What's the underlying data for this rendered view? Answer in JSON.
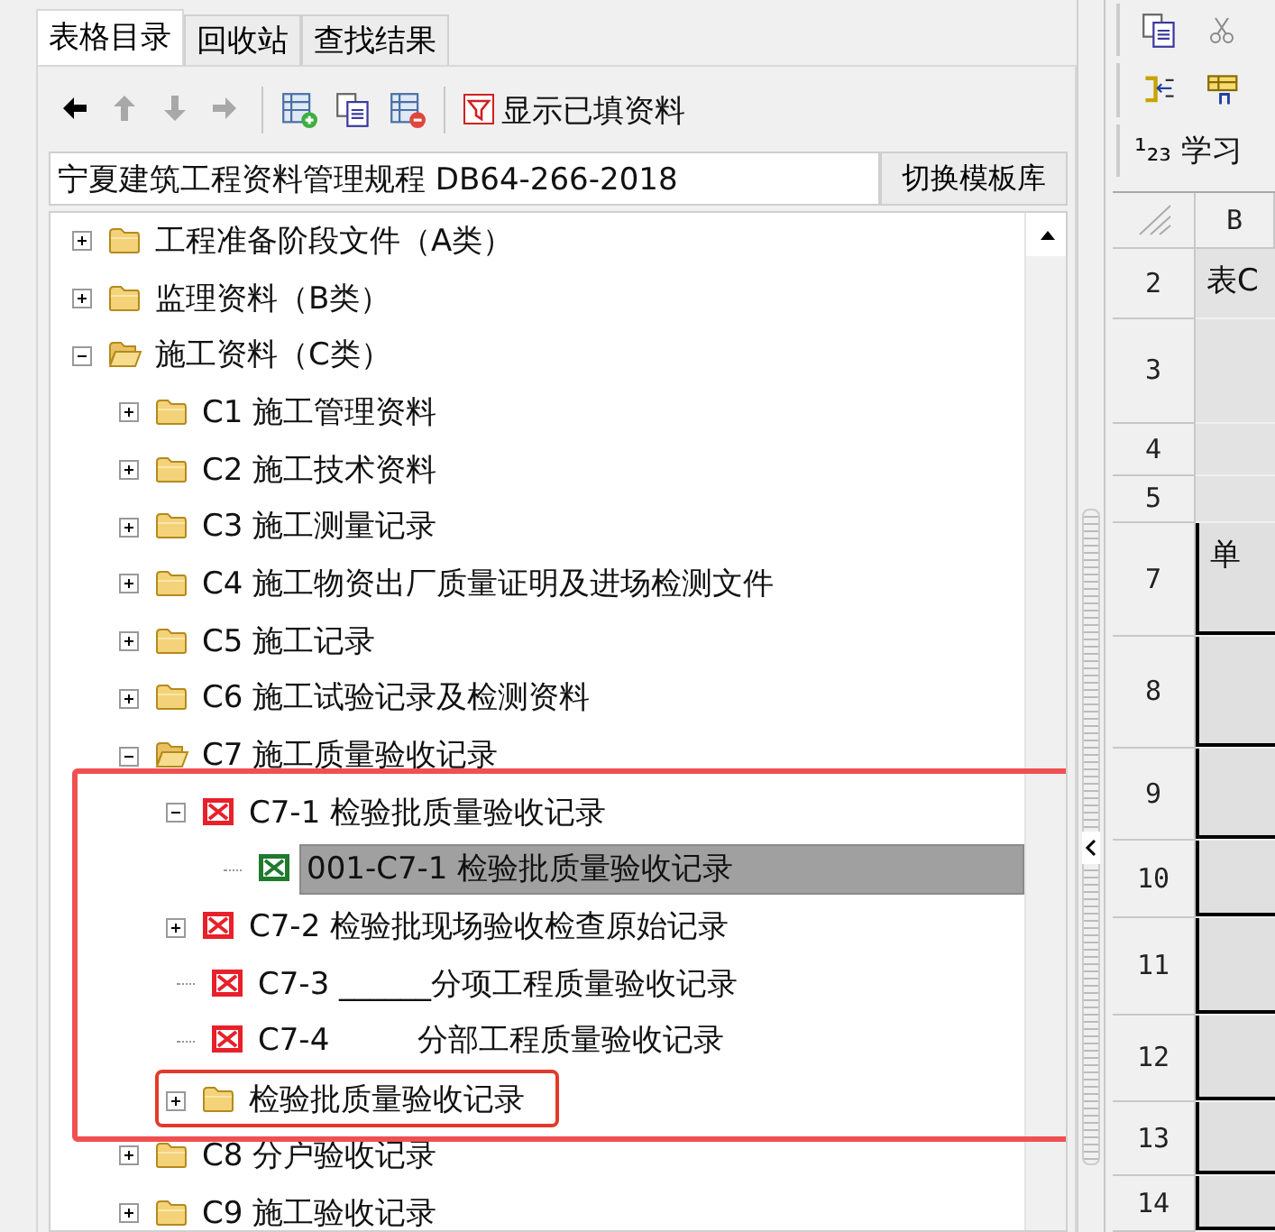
{
  "tabs": [
    {
      "label": "表格目录",
      "selected": true
    },
    {
      "label": "回收站",
      "selected": false
    },
    {
      "label": "查找结果",
      "selected": false
    }
  ],
  "toolbar": {
    "nav": [
      {
        "kind": "left",
        "disabled": false
      },
      {
        "kind": "up",
        "disabled": true
      },
      {
        "kind": "down",
        "disabled": true
      },
      {
        "kind": "right",
        "disabled": true
      }
    ],
    "actions": [
      {
        "kind": "add-table"
      },
      {
        "kind": "copy"
      },
      {
        "kind": "delete-table"
      }
    ],
    "filter_button": "显示已填资料"
  },
  "library": {
    "value": "宁夏建筑工程资料管理规程 DB64-266-2018",
    "button": "切换模板库"
  },
  "tree": [
    {
      "label": "工程准备阶段文件（A类）",
      "kind": "folder",
      "expanded": false
    },
    {
      "label": "监理资料（B类）",
      "kind": "folder",
      "expanded": false
    },
    {
      "label": "施工资料（C类）",
      "kind": "folder",
      "expanded": true,
      "children": [
        {
          "label": "C1 施工管理资料",
          "kind": "folder",
          "expanded": false
        },
        {
          "label": "C2 施工技术资料",
          "kind": "folder",
          "expanded": false
        },
        {
          "label": "C3 施工测量记录",
          "kind": "folder",
          "expanded": false
        },
        {
          "label": "C4 施工物资出厂质量证明及进场检测文件",
          "kind": "folder",
          "expanded": false
        },
        {
          "label": "C5 施工记录",
          "kind": "folder",
          "expanded": false
        },
        {
          "label": "C6 施工试验记录及检测资料",
          "kind": "folder",
          "expanded": false
        },
        {
          "label": "C7 施工质量验收记录",
          "kind": "folder",
          "expanded": true,
          "children_highlighted": true,
          "children": [
            {
              "label": "C7-1 检验批质量验收记录",
              "kind": "form",
              "filled": false,
              "expanded": true,
              "children": [
                {
                  "label": "001-C7-1 检验批质量验收记录",
                  "kind": "form",
                  "filled": true,
                  "selected": true
                }
              ]
            },
            {
              "label": "C7-2 检验批现场验收检查原始记录",
              "kind": "form",
              "filled": false,
              "expanded": false
            },
            {
              "label": "C7-3 ______分项工程质量验收记录",
              "kind": "form",
              "filled": false
            },
            {
              "label": "C7-4         分部工程质量验收记录",
              "kind": "form",
              "filled": false
            },
            {
              "label": "检验批质量验收记录",
              "kind": "folder",
              "expanded": false,
              "highlighted": true
            }
          ]
        },
        {
          "label": "C8 分户验收记录",
          "kind": "folder",
          "expanded": false
        },
        {
          "label": "C9 施工验收记录",
          "kind": "folder",
          "expanded": false
        }
      ]
    }
  ],
  "sheet": {
    "toolbar_label": "¹₂₃ 学习",
    "column_header": "B",
    "rows": [
      {
        "number": "2",
        "cell": "表C",
        "kind": "title"
      },
      {
        "number": "3",
        "kind": "title"
      },
      {
        "number": "4",
        "kind": "title"
      },
      {
        "number": "5",
        "kind": "title"
      },
      {
        "number": "7",
        "cell": "单",
        "kind": "table"
      },
      {
        "number": "8",
        "kind": "table"
      },
      {
        "number": "9",
        "kind": "table"
      },
      {
        "number": "10",
        "kind": "table"
      },
      {
        "number": "11",
        "kind": "table"
      },
      {
        "number": "12",
        "kind": "table"
      },
      {
        "number": "13",
        "kind": "table"
      },
      {
        "number": "14",
        "kind": "table"
      }
    ]
  }
}
